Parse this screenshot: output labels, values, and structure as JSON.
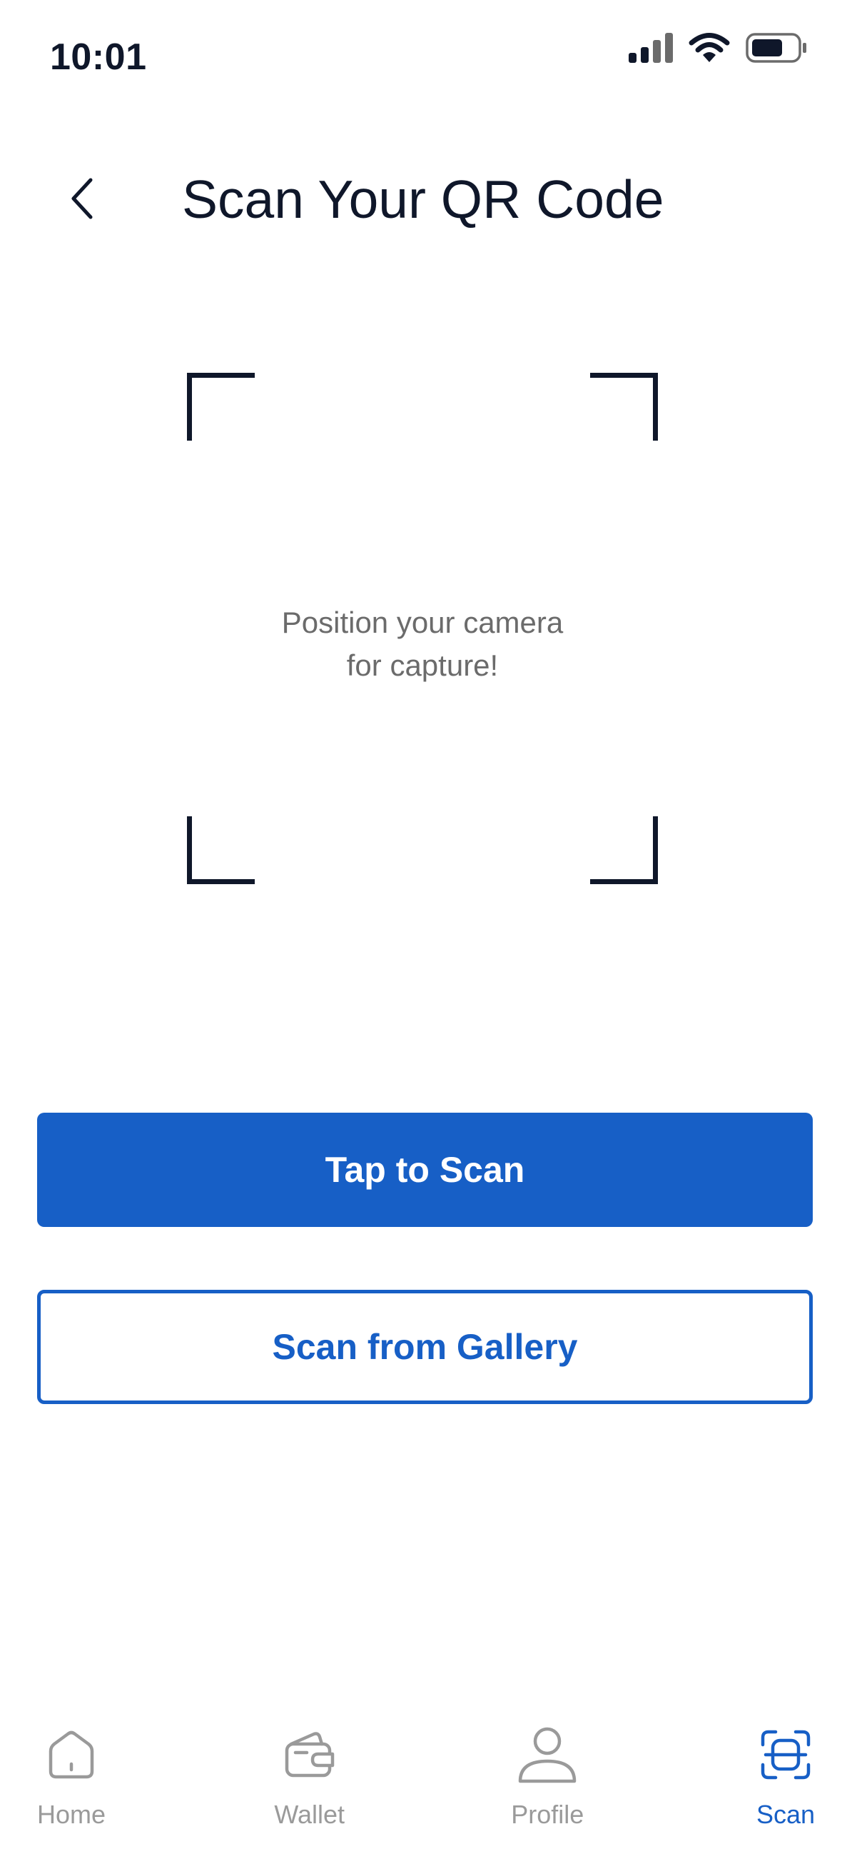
{
  "status_bar": {
    "time": "10:01",
    "icons": [
      "cellular-signal-icon",
      "wifi-icon",
      "battery-icon"
    ]
  },
  "header": {
    "title": "Scan Your QR Code",
    "back_icon": "chevron-left-icon"
  },
  "scanner": {
    "hint": "Position your camera\nfor capture!"
  },
  "actions": {
    "primary_label": "Tap to Scan",
    "secondary_label": "Scan from Gallery"
  },
  "nav": {
    "items": [
      {
        "label": "Home",
        "icon": "home-icon",
        "active": false
      },
      {
        "label": "Wallet",
        "icon": "wallet-icon",
        "active": false
      },
      {
        "label": "Profile",
        "icon": "profile-icon",
        "active": false
      },
      {
        "label": "Scan",
        "icon": "scan-icon",
        "active": true
      }
    ]
  },
  "colors": {
    "primary": "#175fc6",
    "text": "#0f172a",
    "muted": "#9a9a9a",
    "hint": "#6b6b6b"
  }
}
